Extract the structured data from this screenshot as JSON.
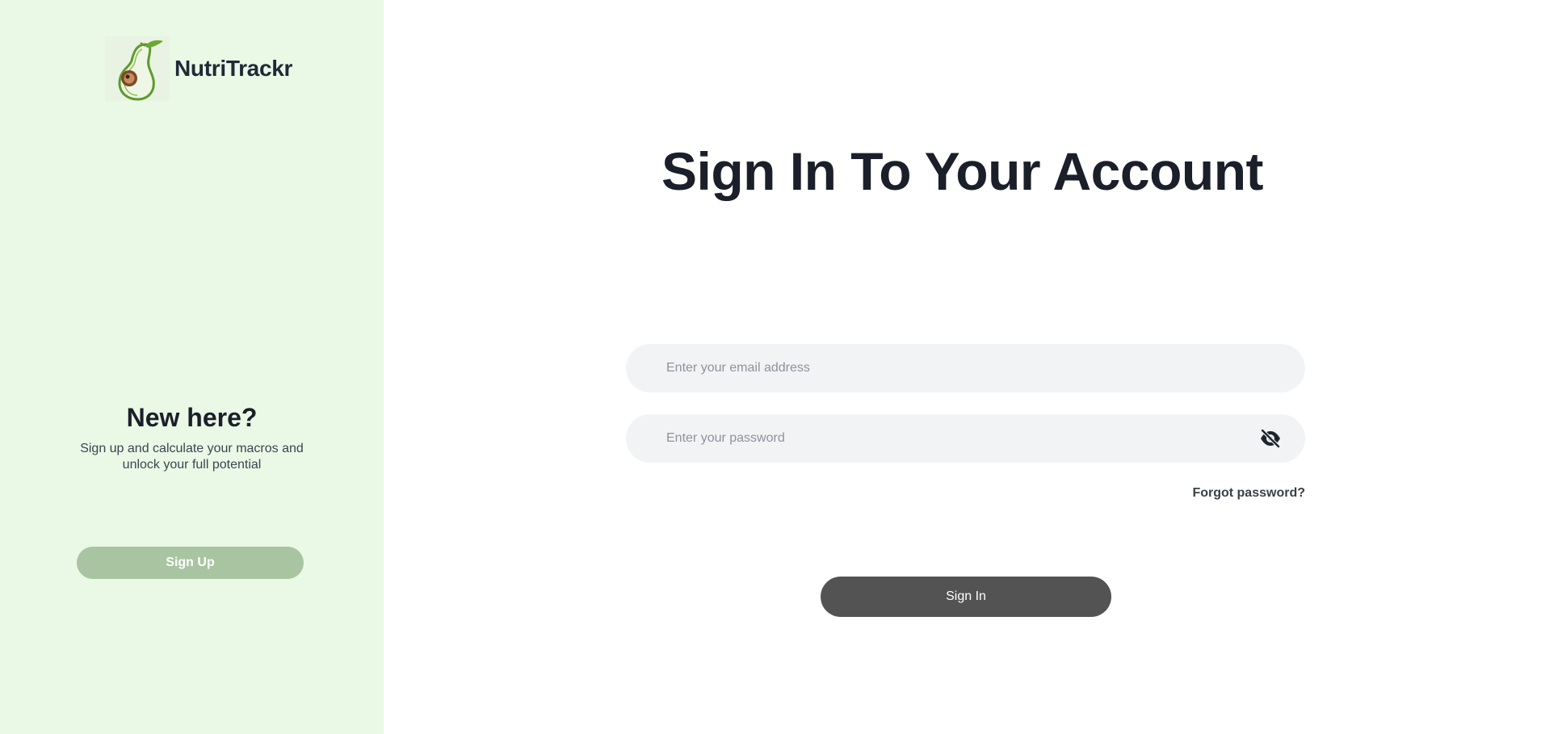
{
  "brand": {
    "name": "NutriTrackr",
    "logo_icon": "avocado-icon"
  },
  "left_panel": {
    "title": "New here?",
    "description": "Sign up and calculate your macros and unlock your full potential",
    "signup_label": "Sign Up",
    "background_color": "#eaf8e6",
    "signup_button_color": "#a9c4a1"
  },
  "main": {
    "title": "Sign In To Your Account",
    "email_placeholder": "Enter your email address",
    "email_value": "",
    "password_placeholder": "Enter your password",
    "password_value": "",
    "password_toggle_icon": "eye-off-icon",
    "forgot_label": "Forgot password?",
    "signin_label": "Sign In",
    "signin_button_color": "#535353"
  }
}
